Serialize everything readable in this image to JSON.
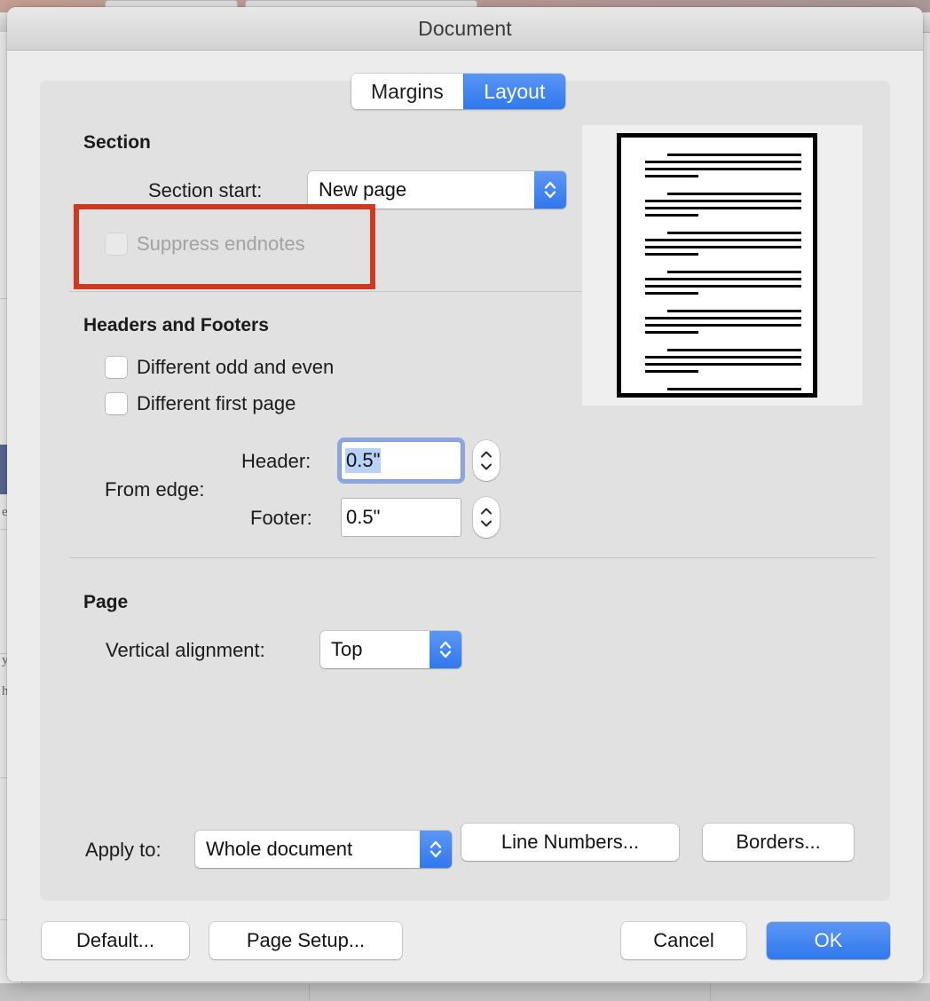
{
  "window": {
    "title": "Document"
  },
  "tabs": [
    {
      "label": "Margins",
      "active": false
    },
    {
      "label": "Layout",
      "active": true
    }
  ],
  "section": {
    "group_title": "Section",
    "section_start": {
      "label": "Section start:",
      "value": "New page"
    },
    "suppress_endnotes": {
      "label": "Suppress endnotes",
      "checked": false,
      "enabled": false
    }
  },
  "headers_and_footers": {
    "group_title": "Headers and Footers",
    "different_odd_and_even": {
      "label": "Different odd and even",
      "checked": false
    },
    "different_first_page": {
      "label": "Different first page",
      "checked": false
    },
    "from_edge_label": "From edge:",
    "header": {
      "label": "Header:",
      "value": "0.5\"",
      "focused": true
    },
    "footer": {
      "label": "Footer:",
      "value": "0.5\"",
      "focused": false
    }
  },
  "page": {
    "group_title": "Page",
    "vertical_alignment": {
      "label": "Vertical alignment:",
      "value": "Top"
    }
  },
  "apply": {
    "label": "Apply to:",
    "value": "Whole document",
    "line_numbers_button": "Line Numbers...",
    "borders_button": "Borders..."
  },
  "footer_buttons": {
    "default": "Default...",
    "page_setup": "Page Setup...",
    "cancel": "Cancel",
    "ok": "OK"
  },
  "preview": {
    "paragraph_count": 7,
    "lines_per_paragraph": [
      "indent",
      "full",
      "full",
      "short"
    ]
  },
  "annotation": {
    "color": "#cf3a1e",
    "target": "suppress-endnotes-checkbox"
  },
  "colors": {
    "accent_blue": "#2f78ef",
    "panel": "#e1e1e1",
    "dialog": "#ececec",
    "selection_blue": "#b7d2f4",
    "disabled_text": "#a2a2a2"
  },
  "background_window": {
    "sidebar_items": [
      "e",
      "y",
      "h"
    ]
  }
}
